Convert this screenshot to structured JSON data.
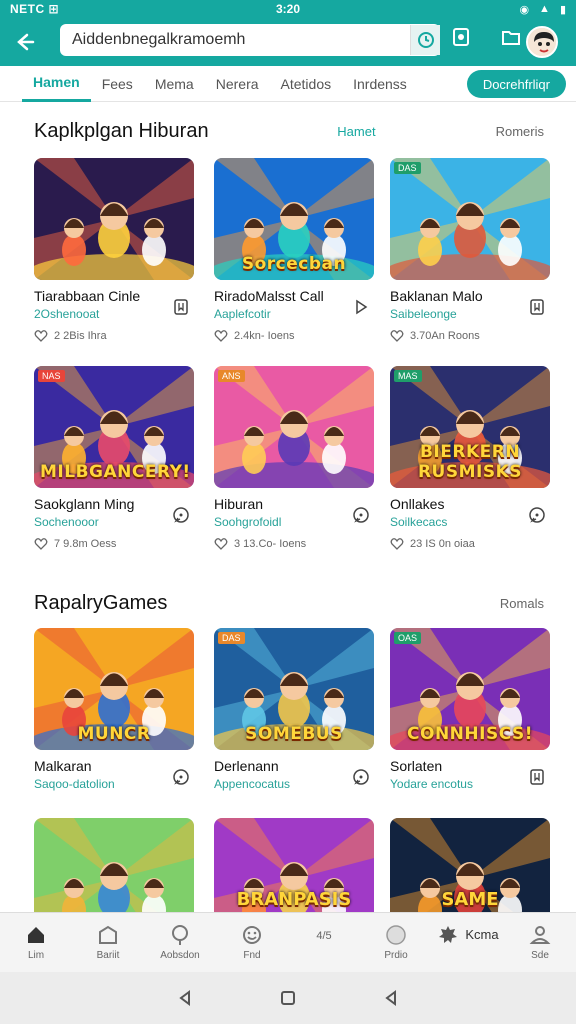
{
  "status_bar": {
    "left": "NETC ⊞",
    "time": "3:20"
  },
  "search": {
    "value": "Aiddenbnegalkramoemh"
  },
  "tabs": [
    {
      "label": "Hamen",
      "active": true
    },
    {
      "label": "Fees"
    },
    {
      "label": "Mema"
    },
    {
      "label": "Nerera"
    },
    {
      "label": "Atetidos"
    },
    {
      "label": "Inrdenss"
    }
  ],
  "tab_cta": "Docrehfrliqr",
  "section1": {
    "title": "Kaplkplgan Hiburan",
    "mid": "Hamet",
    "more": "Romeris"
  },
  "section2": {
    "title": "RapalryGames",
    "more": "Romals"
  },
  "cards1": [
    {
      "name": "Tiarabbaan Cinle",
      "sub": "2Oshenooat",
      "meta": "2 2Bis Ihra",
      "tag": "",
      "icon": "bookmark-icon"
    },
    {
      "name": "RiradoMalsst Call",
      "sub": "Aaplefcotir",
      "meta": "2.4kn- Ioens",
      "tag": "",
      "icon": "play-outline-icon"
    },
    {
      "name": "Baklanan Malo",
      "sub": "Saibeleonge",
      "meta": "3.70An Roons",
      "tag": "DAS",
      "icon": "bookmark-icon"
    },
    {
      "name": "Saokglann Ming",
      "sub": "Sochenooor",
      "meta": "7 9.8m Oess",
      "tag": "NAS",
      "icon": "chat-icon"
    },
    {
      "name": "Hiburan",
      "sub": "Soohgrofoidl",
      "meta": "3 13.Co- Ioens",
      "tag": "ANS",
      "icon": "chat-icon"
    },
    {
      "name": "Onllakes",
      "sub": "Soilkecacs",
      "meta": "23 IS 0n oiaa",
      "tag": "MAS",
      "icon": "chat-icon"
    }
  ],
  "cards2": [
    {
      "name": "Malkaran",
      "sub": "Saqoo-datolion",
      "tag": "",
      "icon": "chat-icon"
    },
    {
      "name": "Derlenann",
      "sub": "Appencocatus",
      "tag": "DAS",
      "icon": "chat-icon"
    },
    {
      "name": "Sorlaten",
      "sub": "Yodare encotus",
      "tag": "OAS",
      "icon": "bookmark-icon"
    }
  ],
  "thumbs": {
    "t2_banner": "Sorcecban",
    "t4_banner": "MILBGANCERY!",
    "t6_banner": "BIERKERN RUSMISKS",
    "t7_banner": "MUNCR",
    "t8_banner": "SOMEBUS",
    "t9_banner": "CONNHISCS!",
    "t11_banner": "BRANPASIS",
    "t12_banner": "SAME"
  },
  "bottom_nav": [
    {
      "label": "Lim",
      "icon": "home-icon"
    },
    {
      "label": "Bariit",
      "icon": "store-icon"
    },
    {
      "label": "Aobsdon",
      "icon": "lollipop-icon"
    },
    {
      "label": "Fnd",
      "icon": "smile-icon"
    },
    {
      "label": "4/5",
      "icon": ""
    },
    {
      "label": "Prdio",
      "icon": "circle-icon"
    },
    {
      "label": "Kcma",
      "icon": "gear-icon"
    },
    {
      "label": "Sde",
      "icon": "person-icon"
    }
  ],
  "colors": {
    "accent": "#15a8a0",
    "text": "#111111",
    "sub": "#28a299"
  }
}
